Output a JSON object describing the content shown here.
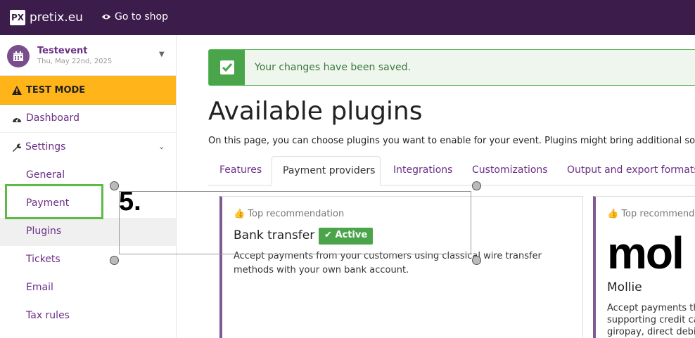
{
  "topbar": {
    "logo_mark": "PX",
    "logo_text": "pretix.eu",
    "shop_link": "Go to shop"
  },
  "sidebar": {
    "event_name": "Testevent",
    "event_date": "Thu, May 22nd, 2025",
    "test_mode": "TEST MODE",
    "dashboard": "Dashboard",
    "settings": "Settings",
    "sub_items": [
      "General",
      "Payment",
      "Plugins",
      "Tickets",
      "Email",
      "Tax rules"
    ]
  },
  "main": {
    "alert": "Your changes have been saved.",
    "title": "Available plugins",
    "description": "On this page, you can choose plugins you want to enable for your event. Plugins might bring additional sof",
    "tabs": [
      "Features",
      "Payment providers",
      "Integrations",
      "Customizations",
      "Output and export formats"
    ],
    "cards": [
      {
        "recommendation": "Top recommendation",
        "title": "Bank transfer",
        "badge": "Active",
        "text": "Accept payments from your customers using classical wire transfer methods with your own bank account."
      },
      {
        "recommendation": "Top recommenda",
        "logo": "mol",
        "title": "Mollie",
        "text_lines": [
          "Accept payments th",
          "supporting credit ca",
          "giropay, direct debi"
        ]
      }
    ]
  },
  "annotation": {
    "step_label": "5."
  },
  "colors": {
    "topbar": "#3b1c4a",
    "accent": "#6b2f86",
    "test_mode": "#ffb419",
    "success": "#4aa54a",
    "highlight": "#5cba47"
  }
}
